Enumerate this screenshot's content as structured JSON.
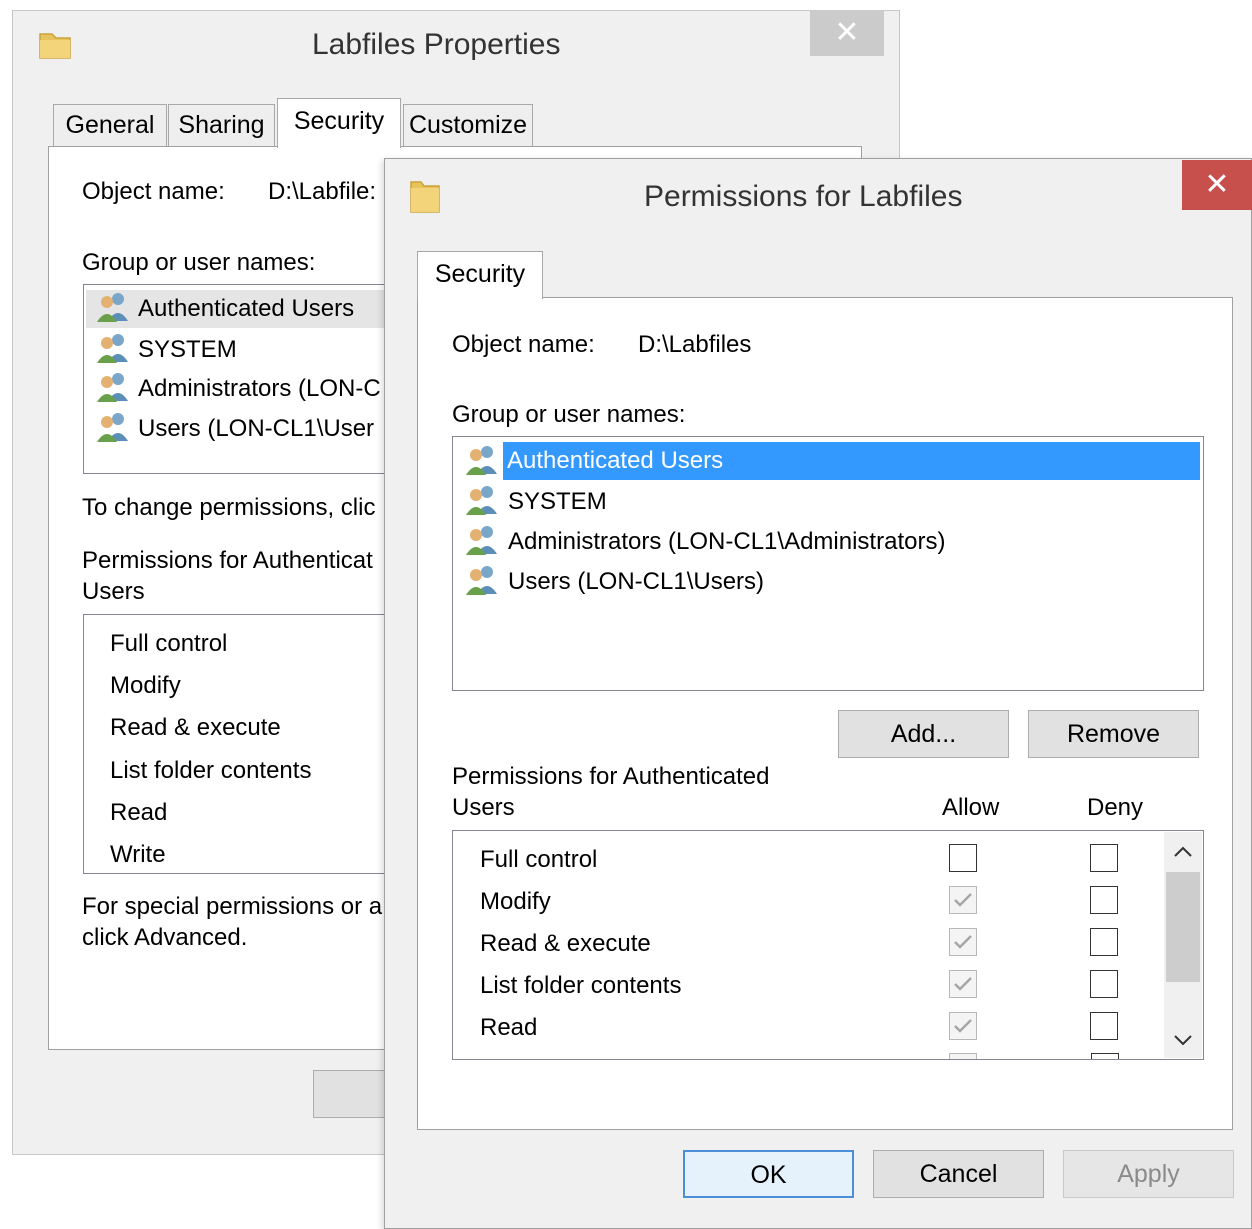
{
  "background_dialog": {
    "title": "Labfiles Properties",
    "close_label": "✕",
    "tabs": [
      "General",
      "Sharing",
      "Security",
      "Customize"
    ],
    "active_tab": "Security",
    "object_name_label": "Object name:",
    "object_name_value": "D:\\Labfile:",
    "group_label": "Group or user names:",
    "users": [
      "Authenticated Users",
      "SYSTEM",
      "Administrators (LON-C",
      "Users (LON-CL1\\User"
    ],
    "change_text": "To change permissions, clic",
    "permissions_label_line1": "Permissions for Authenticat",
    "permissions_label_line2": "Users",
    "permissions": [
      "Full control",
      "Modify",
      "Read & execute",
      "List folder contents",
      "Read",
      "Write"
    ],
    "special_text_line1": "For special permissions or a",
    "special_text_line2": "click Advanced."
  },
  "permissions_dialog": {
    "title": "Permissions for Labfiles",
    "close_label": "✕",
    "tab": "Security",
    "object_name_label": "Object name:",
    "object_name_value": "D:\\Labfiles",
    "group_label": "Group or user names:",
    "users": [
      "Authenticated Users",
      "SYSTEM",
      "Administrators (LON-CL1\\Administrators)",
      "Users (LON-CL1\\Users)"
    ],
    "selected_user": "Authenticated Users",
    "add_button": "Add...",
    "remove_button": "Remove",
    "permissions_label_line1": "Permissions for Authenticated",
    "permissions_label_line2": "Users",
    "allow_header": "Allow",
    "deny_header": "Deny",
    "permissions": [
      {
        "name": "Full control",
        "allow": false,
        "allow_disabled": false,
        "deny": false
      },
      {
        "name": "Modify",
        "allow": true,
        "allow_disabled": true,
        "deny": false
      },
      {
        "name": "Read & execute",
        "allow": true,
        "allow_disabled": true,
        "deny": false
      },
      {
        "name": "List folder contents",
        "allow": true,
        "allow_disabled": true,
        "deny": false
      },
      {
        "name": "Read",
        "allow": true,
        "allow_disabled": true,
        "deny": false
      }
    ],
    "ok_button": "OK",
    "cancel_button": "Cancel",
    "apply_button": "Apply"
  },
  "colors": {
    "selection": "#3399ff",
    "close_active": "#c7504d",
    "close_inactive": "#cbcbcb",
    "folder": "#e8c25a"
  }
}
